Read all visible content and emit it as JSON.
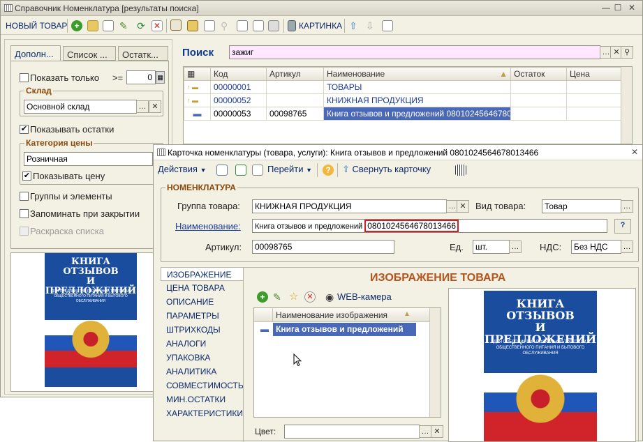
{
  "main_window": {
    "title": "Справочник Номенклатура [результаты поиска]",
    "new_item_label": "НОВЫЙ ТОВАР",
    "picture_label": "КАРТИНКА",
    "tabs": [
      "Дополн...",
      "Список ...",
      "Остатк..."
    ],
    "show_only_label": "Показать только",
    "show_only_op": ">=",
    "show_only_value": "0",
    "warehouse_group": "Склад",
    "warehouse_value": "Основной склад",
    "show_balances_label": "Показывать остатки",
    "price_category_group": "Категория цены",
    "price_category_value": "Розничная",
    "show_price_label": "Показывать цену",
    "groups_elements_label": "Группы и элементы",
    "remember_label": "Запоминать при закрытии",
    "coloring_label": "Раскраска списка",
    "search_label": "Поиск",
    "search_value": "зажиг",
    "columns": [
      "Код",
      "Артикул",
      "Наименование",
      "Остаток",
      "Цена"
    ],
    "rows": [
      {
        "code": "00000001",
        "article": "",
        "name": "ТОВАРЫ",
        "stock": "",
        "price": ""
      },
      {
        "code": "00000052",
        "article": "",
        "name": "КНИЖНАЯ ПРОДУКЦИЯ",
        "stock": "",
        "price": ""
      },
      {
        "code": "00000053",
        "article": "00098765",
        "name": "Книга отзывов и предложений 080102456467801...",
        "stock": "",
        "price": ""
      }
    ]
  },
  "book_cover": {
    "title_line1": "КНИГА",
    "title_line2": "ОТЗЫВОВ",
    "title_line3": "И ПРЕДЛОЖЕНИЙ",
    "subtitle": "ДЛЯ ПРЕДПРИЯТИЙ РОЗНИЧНОЙ ТОРГОВЛИ, ОБЩЕСТВЕННОГО ПИТАНИЯ И БЫТОВОГО ОБСЛУЖИВАНИЯ",
    "small_title_line2": "И ПРЕДЛОЖЕНИЙ",
    "small_title_line1": "КНИГА ОТЗЫВОВ"
  },
  "card": {
    "title": "Карточка номенклатуры (товара, услуги): Книга отзывов и предложений 0801024564678013466",
    "actions_label": "Действия",
    "goto_label": "Перейти",
    "collapse_label": "Свернуть карточку",
    "section_label": "НОМЕНКЛАТУРА",
    "group_label": "Группа товара:",
    "group_value": "КНИЖНАЯ ПРОДУКЦИЯ",
    "kind_label": "Вид товара:",
    "kind_value": "Товар",
    "name_label": "Наименование:",
    "name_value_plain": "Книга отзывов и предложений",
    "name_value_highlight": "0801024564678013466",
    "help_label": "?",
    "article_label": "Артикул:",
    "article_value": "00098765",
    "unit_label": "Ед.",
    "unit_value": "шт.",
    "vat_label": "НДС:",
    "vat_value": "Без НДС",
    "side_tabs": [
      "ИЗОБРАЖЕНИЕ",
      "ЦЕНА ТОВАРА",
      "ОПИСАНИЕ",
      "ПАРАМЕТРЫ",
      "ШТРИХКОДЫ",
      "АНАЛОГИ",
      "УПАКОВКА",
      "АНАЛИТИКА",
      "СОВМЕСТИМОСТЬ",
      "МИН.ОСТАТКИ",
      "ХАРАКТЕРИСТИКИ"
    ],
    "image_heading": "ИЗОБРАЖЕНИЕ ТОВАРА",
    "webcam_label": "WEB-камера",
    "image_col_header": "Наименование изображения",
    "image_row": "Книга отзывов и предложений",
    "color_label": "Цвет:"
  }
}
